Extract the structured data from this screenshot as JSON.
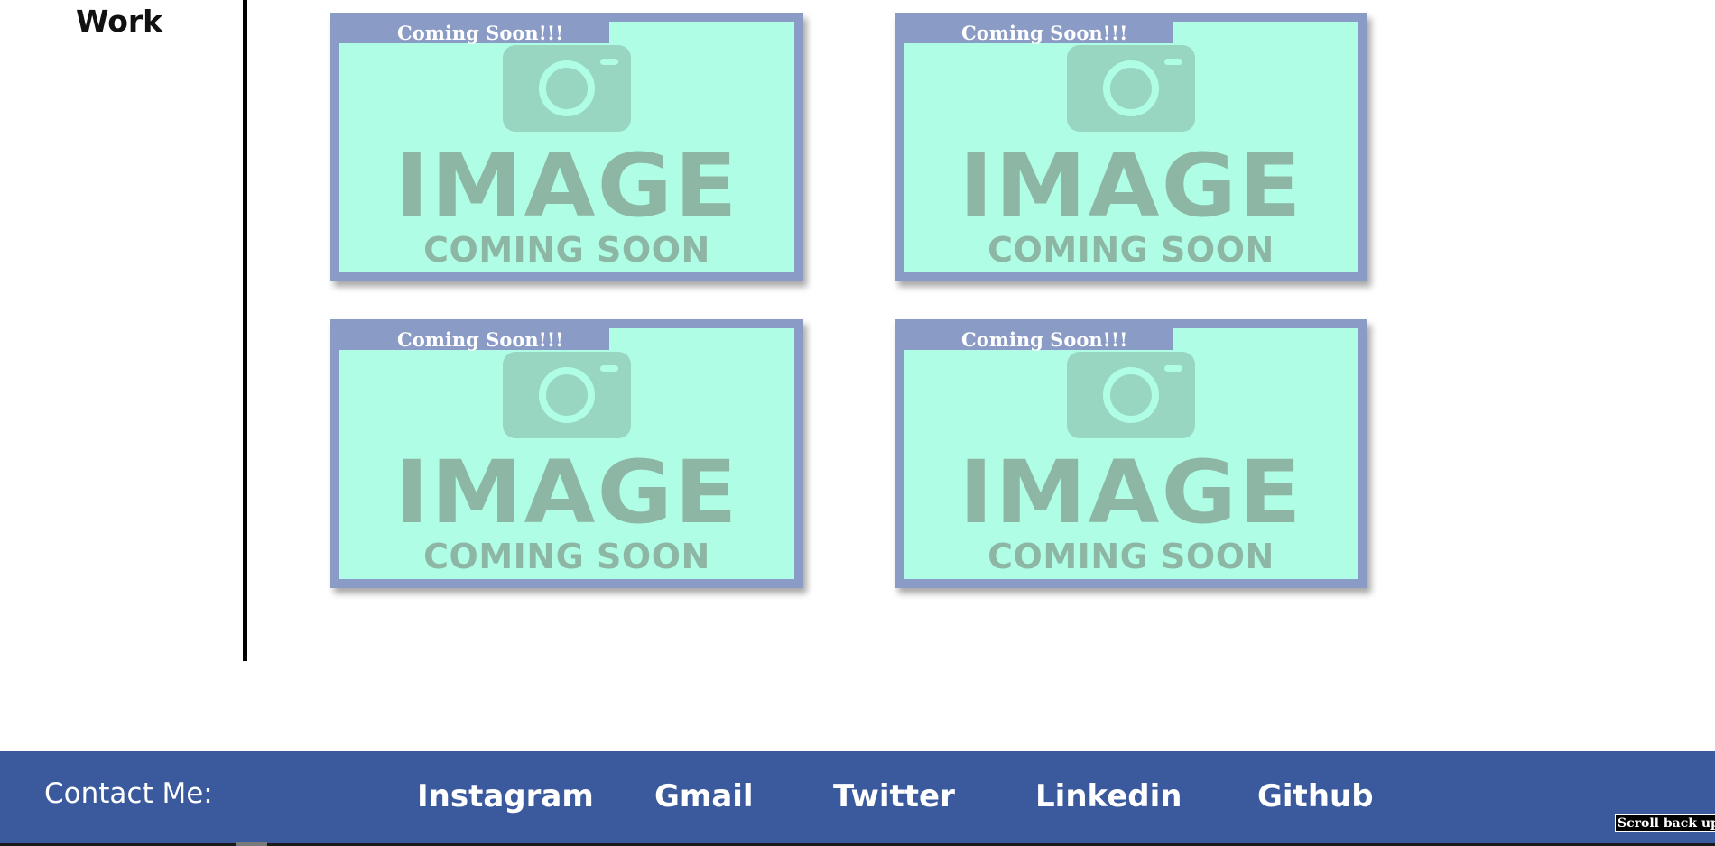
{
  "section": {
    "title": "Work"
  },
  "cards": [
    {
      "badge": "Coming Soon!!!",
      "image_title": "IMAGE",
      "image_subtitle": "COMING SOON"
    },
    {
      "badge": "Coming Soon!!!",
      "image_title": "IMAGE",
      "image_subtitle": "COMING SOON"
    },
    {
      "badge": "Coming Soon!!!",
      "image_title": "IMAGE",
      "image_subtitle": "COMING SOON"
    },
    {
      "badge": "Coming Soon!!!",
      "image_title": "IMAGE",
      "image_subtitle": "COMING SOON"
    }
  ],
  "footer": {
    "contact_label": "Contact Me:",
    "links": [
      {
        "label": "Instagram"
      },
      {
        "label": "Gmail"
      },
      {
        "label": "Twitter"
      },
      {
        "label": "Linkedin"
      },
      {
        "label": "Github"
      }
    ],
    "scroll_top_label": "Scroll back up"
  },
  "icons": {
    "card_image": "camera-icon"
  },
  "colors": {
    "footer_background": "#3b599d",
    "card_frame": "#8a9bc6",
    "card_background": "#b0fde5",
    "placeholder_text": "#8db6a4",
    "divider": "#000000"
  }
}
